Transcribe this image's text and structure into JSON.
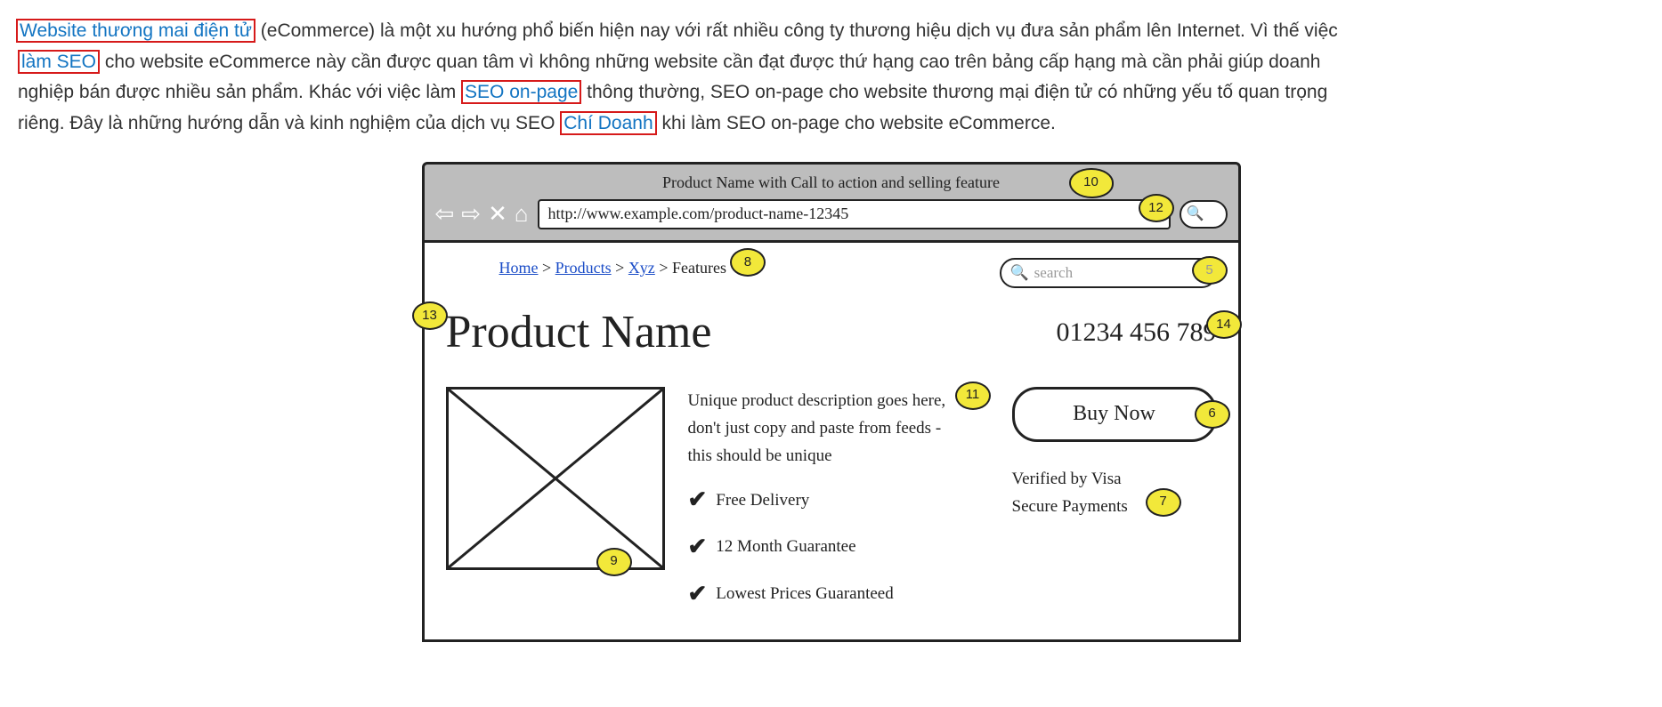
{
  "article": {
    "link_ecommerce": "Website thương mai điện tử",
    "text1": " (eCommerce) là một xu hướng phổ biến hiện nay với rất nhiều công ty thương hiệu dịch vụ đưa sản phẩm lên Internet. Vì thế việc ",
    "link_seo": "làm SEO",
    "text2": " cho website eCommerce này cần được quan tâm vì không những website cần đạt được thứ hạng cao trên bảng cấp hạng mà cần phải giúp doanh nghiệp bán được nhiều sản phẩm. Khác với việc làm ",
    "link_onpage": "SEO on-page",
    "text3": " thông thường, SEO on-page cho website thương mại điện tử có những yếu tố quan trọng riêng. Đây là những hướng dẫn và kinh nghiệm của dịch vụ SEO ",
    "link_chidoanh": "Chí Doanh",
    "text4": " khi làm SEO on-page cho website eCommerce."
  },
  "wireframe": {
    "chrome_title": "Product Name with Call to action and selling feature",
    "url": "http://www.example.com/product-name-12345",
    "breadcrumb": {
      "home": "Home",
      "products": "Products",
      "xyz": "Xyz",
      "features": "Features",
      "sep": ">"
    },
    "search_placeholder": "search",
    "product_title": "Product Name",
    "phone": "01234 456 789",
    "description": "Unique product description goes here, don't just copy and paste from feeds - this should be unique",
    "features": [
      "Free Delivery",
      "12 Month Guarantee",
      "Lowest Prices Guaranteed"
    ],
    "buy_label": "Buy Now",
    "verify_line1": "Verified by Visa",
    "verify_line2": "Secure Payments",
    "callouts": {
      "c5": "5",
      "c6": "6",
      "c7": "7",
      "c8": "8",
      "c9": "9",
      "c10": "10",
      "c11": "11",
      "c12": "12",
      "c13": "13",
      "c14": "14"
    }
  }
}
